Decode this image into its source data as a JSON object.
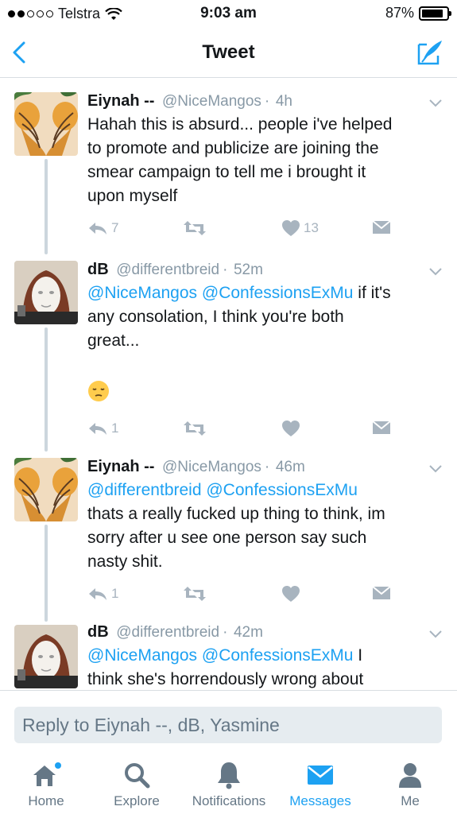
{
  "status_bar": {
    "carrier": "Telstra",
    "time": "9:03 am",
    "battery": "87%",
    "battery_level": 0.87
  },
  "nav": {
    "title": "Tweet"
  },
  "tweets": [
    {
      "name": "Eiynah --",
      "handle": "@NiceMangos",
      "time": "4h",
      "lines": [
        "Hahah this is absurd... people i've helped",
        "to promote and publicize are joining the",
        "smear campaign to tell me i brought it",
        "upon myself"
      ],
      "reply_count": "7",
      "like_count": "13"
    },
    {
      "name": "dB",
      "handle": "@differentbreid",
      "time": "52m",
      "mentions": "@NiceMangos @ConfessionsExMu",
      "lines": [
        " if it's",
        "any consolation, I think you're both",
        "great..."
      ],
      "emoji": "pensive-face",
      "reply_count": "1",
      "like_count": ""
    },
    {
      "name": "Eiynah --",
      "handle": "@NiceMangos",
      "time": "46m",
      "mentions": "@differentbreid @ConfessionsExMu",
      "lines": [
        "thats a really fucked up thing to think, im",
        "sorry after u see one person say such",
        "nasty shit."
      ],
      "reply_count": "1",
      "like_count": ""
    },
    {
      "name": "dB",
      "handle": "@differentbreid",
      "time": "42m",
      "mentions": "@NiceMangos @ConfessionsExMu",
      "lines": [
        " I",
        "think she's horrendously wrong about"
      ],
      "reply_count": "",
      "like_count": ""
    }
  ],
  "reply": {
    "placeholder": "Reply to Eiynah --, dB, Yasmine"
  },
  "tabs": [
    {
      "label": "Home",
      "icon": "home-icon"
    },
    {
      "label": "Explore",
      "icon": "search-icon"
    },
    {
      "label": "Notifications",
      "icon": "bell-icon"
    },
    {
      "label": "Messages",
      "icon": "envelope-icon"
    },
    {
      "label": "Me",
      "icon": "person-icon"
    }
  ],
  "colors": {
    "accent": "#1da1f2",
    "muted": "#8899a6",
    "icon_gray": "#a8b4bf"
  }
}
